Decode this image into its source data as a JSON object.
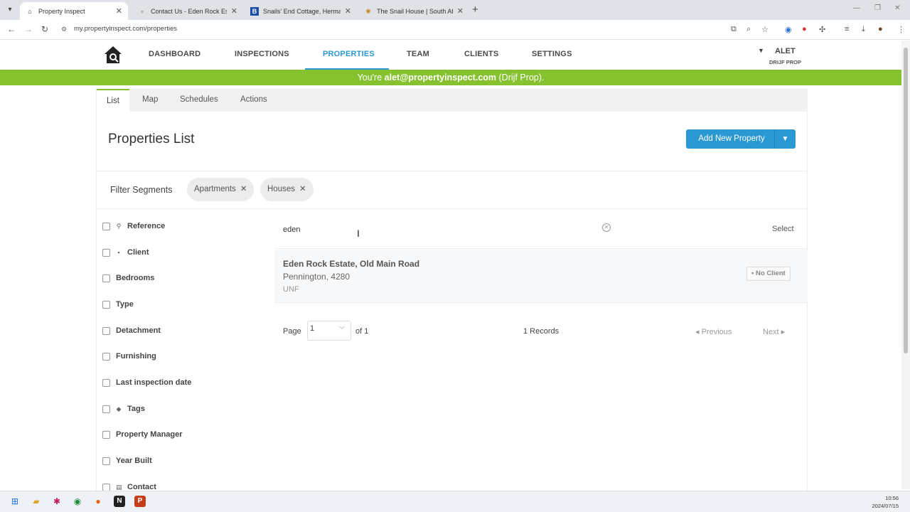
{
  "browser": {
    "tabs": [
      {
        "title": "Property Inspect",
        "active": true
      },
      {
        "title": "Contact Us - Eden Rock Estate",
        "active": false
      },
      {
        "title": "Snails' End Cottage, Hermanus",
        "active": false
      },
      {
        "title": "The Snail House | South Africa",
        "active": false
      }
    ],
    "url": "my.propertyinspect.com/properties"
  },
  "nav": {
    "items": [
      "DASHBOARD",
      "INSPECTIONS",
      "PROPERTIES",
      "TEAM",
      "CLIENTS",
      "SETTINGS"
    ],
    "active": "PROPERTIES",
    "user_name": "ALET",
    "user_org": "DRIJF PROP"
  },
  "banner": {
    "prefix": "You're ",
    "email": "alet@propertyinspect.com",
    "suffix": " (Drijf Prop)."
  },
  "subtabs": [
    "List",
    "Map",
    "Schedules",
    "Actions"
  ],
  "page": {
    "title": "Properties List",
    "add_button": "Add New Property"
  },
  "filters": {
    "label": "Filter Segments",
    "chips": [
      "Apartments",
      "Houses"
    ],
    "fields": [
      "Reference",
      "Client",
      "Bedrooms",
      "Type",
      "Detachment",
      "Furnishing",
      "Last inspection date",
      "Tags",
      "Property Manager",
      "Year Built",
      "Contact"
    ]
  },
  "search": {
    "value": "eden",
    "select_label": "Select"
  },
  "results": [
    {
      "title": "Eden Rock Estate, Old Main Road",
      "address": "Pennington, 4280",
      "tag": "UNF",
      "client": "No Client"
    }
  ],
  "pager": {
    "page_label": "Page",
    "page": "1",
    "of_label": "of 1",
    "records": "1 Records",
    "prev": "Previous",
    "next": "Next"
  },
  "taskbar": {
    "time": "10:56",
    "date": "2024/07/15"
  },
  "colors": {
    "accent": "#2a98d2",
    "banner": "#86c12f"
  }
}
